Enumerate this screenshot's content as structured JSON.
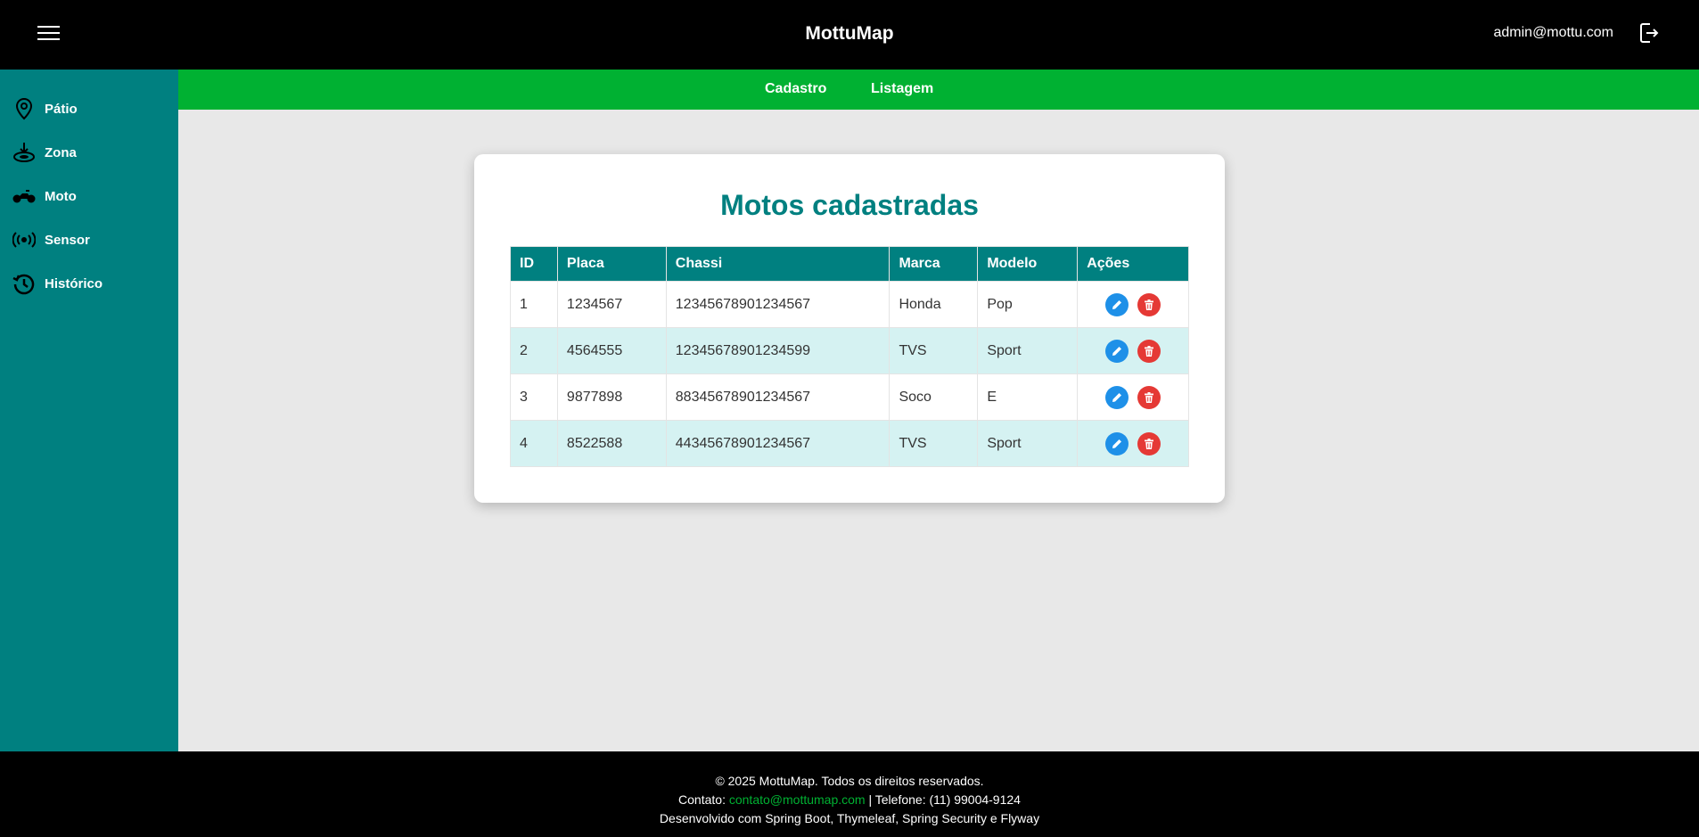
{
  "header": {
    "brand": "MottuMap",
    "user_email": "admin@mottu.com"
  },
  "sidebar": {
    "items": [
      {
        "label": "Pátio",
        "icon": "map-pin-icon"
      },
      {
        "label": "Zona",
        "icon": "zone-icon"
      },
      {
        "label": "Moto",
        "icon": "motorcycle-icon"
      },
      {
        "label": "Sensor",
        "icon": "sensor-icon"
      },
      {
        "label": "Histórico",
        "icon": "history-icon"
      }
    ]
  },
  "subnav": {
    "cadastro": "Cadastro",
    "listagem": "Listagem"
  },
  "main": {
    "title": "Motos cadastradas",
    "columns": [
      "ID",
      "Placa",
      "Chassi",
      "Marca",
      "Modelo",
      "Ações"
    ],
    "rows": [
      [
        "1",
        "1234567",
        "12345678901234567",
        "Honda",
        "Pop"
      ],
      [
        "2",
        "4564555",
        "12345678901234599",
        "TVS",
        "Sport"
      ],
      [
        "3",
        "9877898",
        "88345678901234567",
        "Soco",
        "E"
      ],
      [
        "4",
        "8522588",
        "44345678901234567",
        "TVS",
        "Sport"
      ]
    ]
  },
  "footer": {
    "copyright": "© 2025 MottuMap. Todos os direitos reservados.",
    "contact_prefix": "Contato:",
    "contact_email": "contato@mottumap.com",
    "phone": "| Telefone: (11) 99004-9124",
    "tech": "Desenvolvido com Spring Boot, Thymeleaf, Spring Security e Flyway"
  },
  "colors": {
    "header_bg": "#000000",
    "sidebar_bg": "#008080",
    "subnav_bg": "#00b132",
    "accent": "#008080",
    "edit": "#1e90e8",
    "delete": "#e53935"
  }
}
